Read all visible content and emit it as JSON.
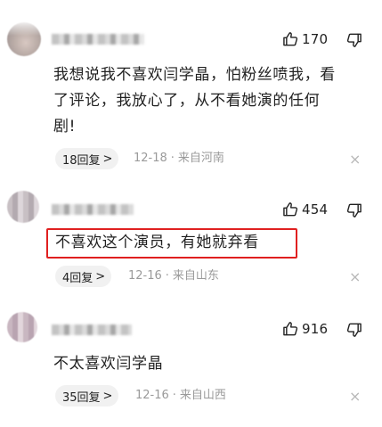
{
  "comments": [
    {
      "likes": "170",
      "text": "我想说我不喜欢闫学晶，怕粉丝喷我，看了评论，我放心了，从不看她演的任何剧!",
      "text_lines": [
        "我想说我不喜欢闫学晶，怕粉丝喷我，看",
        "了评论，我放心了，从不看她演的任何",
        "剧!"
      ],
      "reply_label": "18回复",
      "date": "12-18",
      "location": "来自河南"
    },
    {
      "likes": "454",
      "text": "不喜欢这个演员，有她就弃看",
      "reply_label": "4回复",
      "date": "12-16",
      "location": "来自山东",
      "highlighted": true
    },
    {
      "likes": "916",
      "text": "不太喜欢闫学晶",
      "reply_label": "35回复",
      "date": "12-16",
      "location": "来自山西"
    }
  ],
  "icons": {
    "like": "thumb-up-outline-icon",
    "dislike": "thumb-down-outline-icon",
    "reply_chevron": "chevron-right-icon",
    "close": "close-icon"
  },
  "colors": {
    "highlight_border": "#e02020",
    "meta_text": "#9a9a9a",
    "pill_bg": "#f1f1f1"
  }
}
